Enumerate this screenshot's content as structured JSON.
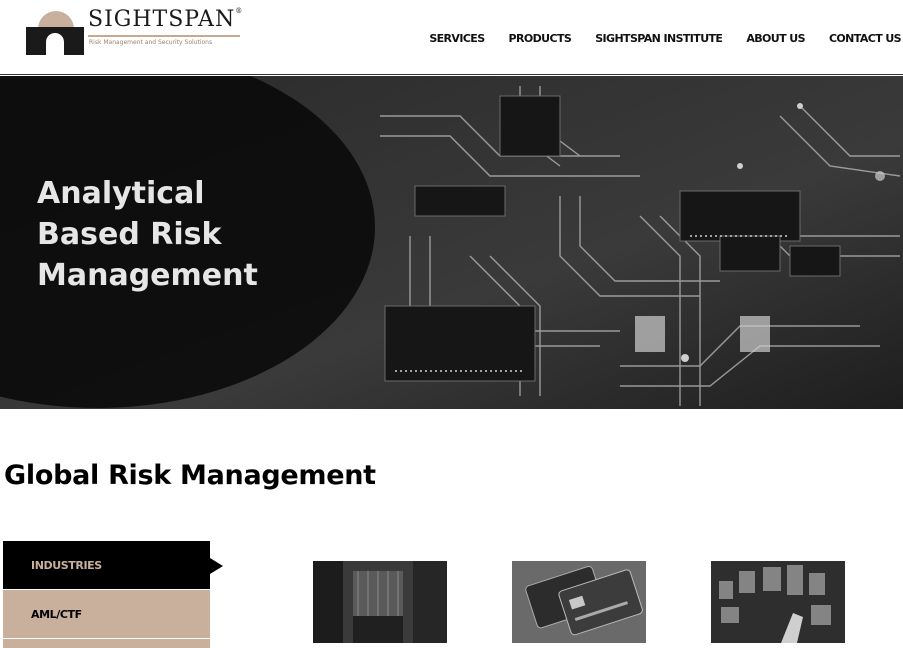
{
  "brand": {
    "name": "SIGHTSPAN",
    "registered": "®",
    "tagline": "Risk Management and Security Solutions",
    "accent_color": "#c9b09c"
  },
  "nav": {
    "items": [
      {
        "label": "SERVICES"
      },
      {
        "label": "PRODUCTS"
      },
      {
        "label": "SIGHTSPAN INSTITUTE"
      },
      {
        "label": "ABOUT US"
      },
      {
        "label": "CONTACT US"
      }
    ]
  },
  "hero": {
    "line1": "Analytical",
    "line2": "Based Risk",
    "line3": "Management",
    "image": "circuit-board-photo"
  },
  "section": {
    "title": "Global Risk Management",
    "tabs": [
      {
        "label": "INDUSTRIES",
        "active": true
      },
      {
        "label": "AML/CTF",
        "active": false
      },
      {
        "label": "",
        "active": false
      }
    ],
    "thumbnails": [
      {
        "image": "vault-door-photo"
      },
      {
        "image": "credit-cards-photo"
      },
      {
        "image": "digital-interface-photo"
      }
    ]
  }
}
